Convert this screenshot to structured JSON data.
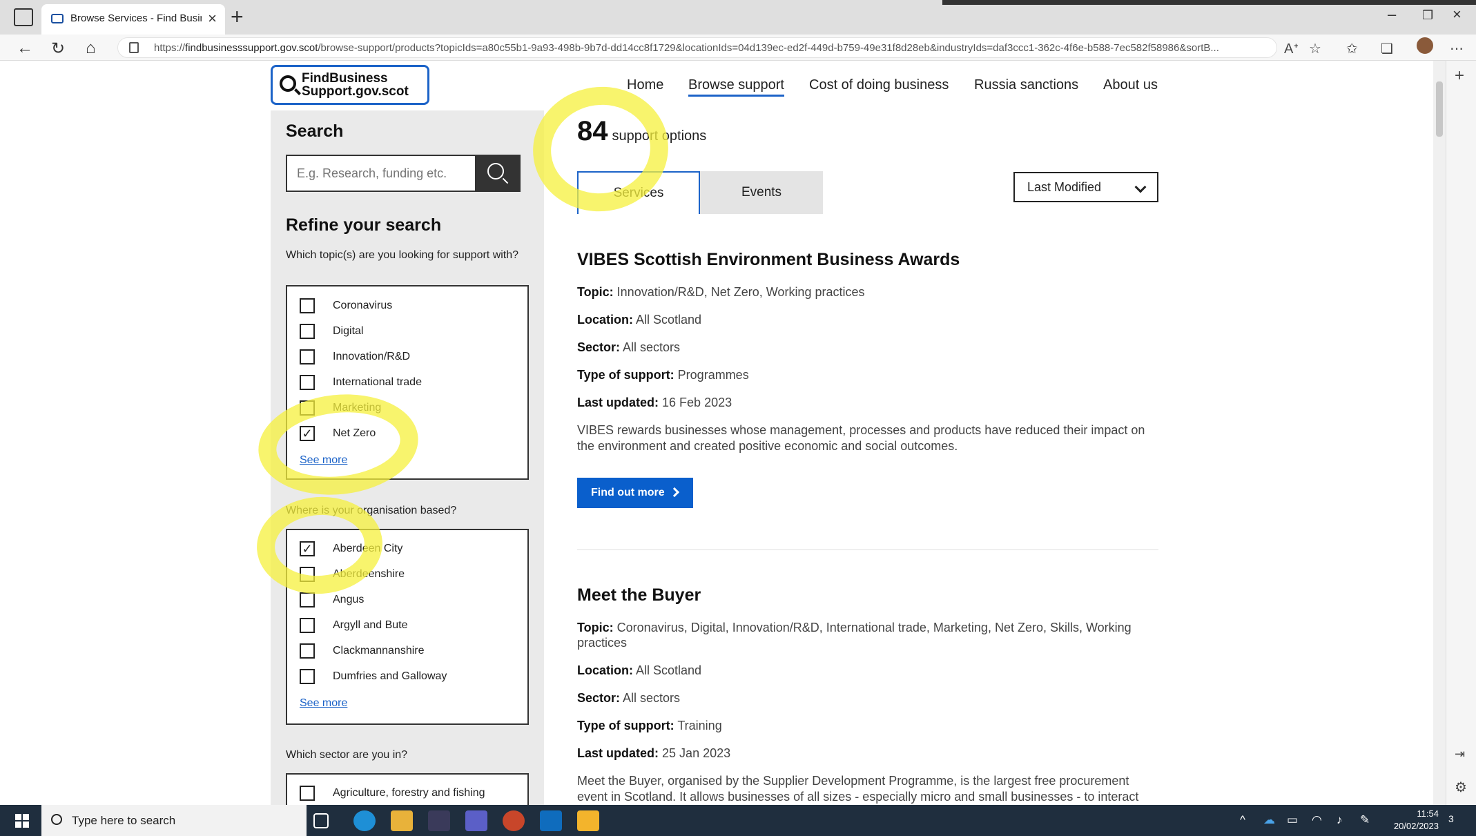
{
  "browser": {
    "tab_title": "Browse Services - Find Business S",
    "url_prefix": "https://",
    "url_host": "findbusinesssupport.gov.scot",
    "url_rest": "/browse-support/products?topicIds=a80c55b1-9a93-498b-9b7d-dd14cc8f1729&locationIds=04d139ec-ed2f-449d-b759-49e31f8d28eb&industryIds=daf3ccc1-362c-4f6e-b588-7ec582f58986&sortB..."
  },
  "site": {
    "logo_line1": "FindBusiness",
    "logo_line2": "Support.gov.scot",
    "nav": [
      "Home",
      "Browse support",
      "Cost of doing business",
      "Russia sanctions",
      "About us"
    ]
  },
  "sidebar": {
    "search_heading": "Search",
    "search_placeholder": "E.g. Research, funding etc.",
    "refine_heading": "Refine your search",
    "topic_question": "Which topic(s) are you looking for support with?",
    "topics": [
      {
        "label": "Coronavirus",
        "checked": false
      },
      {
        "label": "Digital",
        "checked": false
      },
      {
        "label": "Innovation/R&D",
        "checked": false
      },
      {
        "label": "International trade",
        "checked": false
      },
      {
        "label": "Marketing",
        "checked": false
      },
      {
        "label": "Net Zero",
        "checked": true
      }
    ],
    "see_more": "See more",
    "location_question": "Where is your organisation based?",
    "locations": [
      {
        "label": "Aberdeen City",
        "checked": true
      },
      {
        "label": "Aberdeenshire",
        "checked": false
      },
      {
        "label": "Angus",
        "checked": false
      },
      {
        "label": "Argyll and Bute",
        "checked": false
      },
      {
        "label": "Clackmannanshire",
        "checked": false
      },
      {
        "label": "Dumfries and Galloway",
        "checked": false
      }
    ],
    "sector_question": "Which sector are you in?",
    "sectors": [
      {
        "label": "Agriculture, forestry and fishing",
        "checked": false
      }
    ]
  },
  "results": {
    "count": "84",
    "count_label": "support options",
    "tabs": [
      "Services",
      "Events"
    ],
    "sort_value": "Last Modified",
    "items": [
      {
        "title": "VIBES Scottish Environment Business Awards",
        "topic_label": "Topic:",
        "topic": "Innovation/R&D, Net Zero, Working practices",
        "location_label": "Location:",
        "location": "All Scotland",
        "sector_label": "Sector:",
        "sector": "All sectors",
        "type_label": "Type of support:",
        "type": "Programmes",
        "updated_label": "Last updated:",
        "updated": "16 Feb 2023",
        "description": "VIBES rewards businesses whose management, processes and products have reduced their impact on the environment and created positive economic and social outcomes.",
        "button": "Find out more"
      },
      {
        "title": "Meet the Buyer",
        "topic_label": "Topic:",
        "topic": "Coronavirus, Digital, Innovation/R&D, International trade, Marketing, Net Zero, Skills, Working practices",
        "location_label": "Location:",
        "location": "All Scotland",
        "sector_label": "Sector:",
        "sector": "All sectors",
        "type_label": "Type of support:",
        "type": "Training",
        "updated_label": "Last updated:",
        "updated": "25 Jan 2023",
        "description": "Meet the Buyer, organised by the Supplier Development Programme, is the largest free procurement event in Scotland. It allows businesses of all sizes - especially micro and small businesses - to interact with"
      }
    ]
  },
  "taskbar": {
    "search_text": "Type here to search",
    "time": "11:54",
    "date": "20/02/2023",
    "notification_count": "3"
  },
  "colors": {
    "accent": "#1c63c8",
    "button": "#0a5fcc",
    "highlight": "#f5f03c"
  }
}
